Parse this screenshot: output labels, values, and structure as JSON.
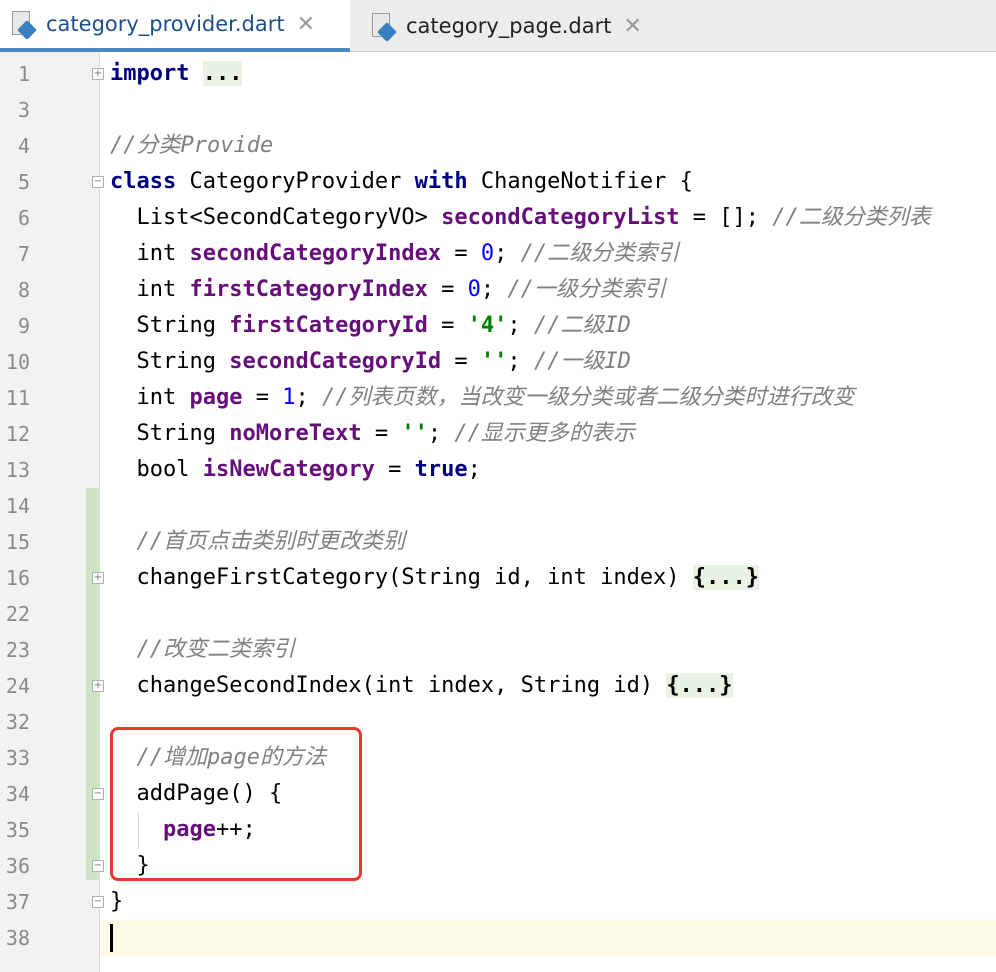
{
  "tabs": [
    {
      "label": "category_provider.dart",
      "active": true
    },
    {
      "label": "category_page.dart",
      "active": false
    }
  ],
  "close_glyph": "✕",
  "line_numbers": [
    "1",
    "3",
    "4",
    "5",
    "6",
    "7",
    "8",
    "9",
    "10",
    "11",
    "12",
    "13",
    "14",
    "15",
    "16",
    "22",
    "23",
    "24",
    "32",
    "33",
    "34",
    "35",
    "36",
    "37",
    "38"
  ],
  "code": {
    "l1": {
      "kw": "import",
      "fold": "..."
    },
    "l4": {
      "comment": "//分类Provide"
    },
    "l5": {
      "kw1": "class",
      "name": " CategoryProvider ",
      "kw2": "with",
      "rest": " ChangeNotifier {"
    },
    "l6": {
      "type": "List<SecondCategoryVO> ",
      "field": "secondCategoryList",
      "rest": " = []; ",
      "comment": "//二级分类列表"
    },
    "l7": {
      "type": "int ",
      "field": "secondCategoryIndex",
      "eq": " = ",
      "num": "0",
      "semi": "; ",
      "comment": "//二级分类索引"
    },
    "l8": {
      "type": "int ",
      "field": "firstCategoryIndex",
      "eq": " = ",
      "num": "0",
      "semi": "; ",
      "comment": "//一级分类索引"
    },
    "l9": {
      "type": "String ",
      "field": "firstCategoryId",
      "eq": " = ",
      "str": "'4'",
      "semi": "; ",
      "comment": "//二级ID"
    },
    "l10": {
      "type": "String ",
      "field": "secondCategoryId",
      "eq": " = ",
      "str": "''",
      "semi": "; ",
      "comment": "//一级ID"
    },
    "l11": {
      "type": "int ",
      "field": "page",
      "eq": " = ",
      "num": "1",
      "semi": "; ",
      "comment": "//列表页数，当改变一级分类或者二级分类时进行改变"
    },
    "l12": {
      "type": "String ",
      "field": "noMoreText",
      "eq": " = ",
      "str": "''",
      "semi": "; ",
      "comment": "//显示更多的表示"
    },
    "l13": {
      "type": "bool ",
      "field": "isNewCategory",
      "eq": " = ",
      "kw": "true",
      "semi": ";"
    },
    "l15": {
      "comment": "//首页点击类别时更改类别"
    },
    "l16": {
      "text": "changeFirstCategory(String id, int index) ",
      "fold": "{...}"
    },
    "l23": {
      "comment": "//改变二类索引"
    },
    "l24": {
      "text": "changeSecondIndex(int index, String id) ",
      "fold": "{...}"
    },
    "l33": {
      "comment": "//增加page的方法"
    },
    "l34": {
      "text": "addPage() {"
    },
    "l35": {
      "field": "page",
      "rest": "++;"
    },
    "l36": {
      "text": "}"
    },
    "l37": {
      "text": "}"
    }
  },
  "colors": {
    "keyword": "#000080",
    "field": "#660e7a",
    "comment": "#808080",
    "number": "#0000ff",
    "string": "#008000",
    "highlight_box": "#e8382e",
    "vcs_added": "#cfe3c5",
    "current_line": "#fdfbe6"
  },
  "icons": {
    "file": "dart-file-icon",
    "close": "close-icon"
  }
}
